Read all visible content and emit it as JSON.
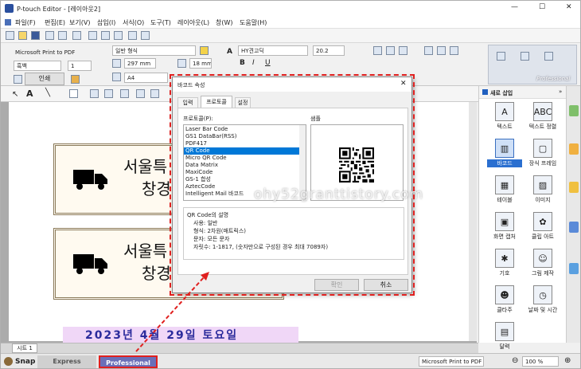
{
  "window": {
    "title": "P-touch Editor - [레이아웃2]",
    "controls": {
      "minimize": "—",
      "maximize": "☐",
      "close": "✕"
    }
  },
  "menu": [
    "파일(F)",
    "편집(E)",
    "보기(V)",
    "삽입(I)",
    "서식(O)",
    "도구(T)",
    "레이아웃(L)",
    "창(W)",
    "도움말(H)"
  ],
  "ribbon": {
    "printer": "Microsoft Print to PDF",
    "color": "흑백",
    "copies": "1",
    "print_label": "인쇄",
    "paper_format": "일반 형식",
    "width": "297 mm",
    "height": "18 mm",
    "paper_size": "A4",
    "font": "HY견고딕",
    "font_size": "20.2",
    "bold": "B",
    "italic": "I",
    "underline": "U",
    "tbox": "A",
    "mode_label": "Professional"
  },
  "right_panel": {
    "title": "새로 삽입",
    "items": [
      {
        "label": "텍스트",
        "glyph": "A"
      },
      {
        "label": "텍스트 정렬",
        "glyph": "ABC"
      },
      {
        "label": "바코드",
        "glyph": "▥"
      },
      {
        "label": "장식 프레임",
        "glyph": "▢"
      },
      {
        "label": "테이블",
        "glyph": "▦"
      },
      {
        "label": "이미지",
        "glyph": "▨"
      },
      {
        "label": "화면 캡처",
        "glyph": "▣"
      },
      {
        "label": "클립 아트",
        "glyph": "✿"
      },
      {
        "label": "기호",
        "glyph": "✱"
      },
      {
        "label": "그림 제작",
        "glyph": "☺"
      },
      {
        "label": "클타주",
        "glyph": "☻"
      },
      {
        "label": "날짜 및 시간",
        "glyph": "◷"
      },
      {
        "label": "달력",
        "glyph": "▤"
      }
    ]
  },
  "canvas": {
    "card_text_1": "서울특",
    "card_text_2": "창경",
    "date_text": "2023년 4월 29일 토요일"
  },
  "dialog": {
    "title": "바코드 속성",
    "close": "✕",
    "tabs": [
      "입력",
      "프로토콜",
      "설정"
    ],
    "protocol_label": "프로토콜(P):",
    "sample_label": "샘플",
    "protocols": [
      "Laser Bar Code",
      "GS1 DataBar(RSS)",
      "PDF417",
      "QR Code",
      "Micro QR Code",
      "Data Matrix",
      "MaxiCode",
      "GS-1 합성",
      "AztecCode",
      "Intelligent Mail 바코드"
    ],
    "selected_protocol": "QR Code",
    "desc_title": "QR Code의 설명",
    "desc_lines": [
      "사용: 일반",
      "형식: 2차원(매트릭스)",
      "문자: 모든 문자",
      "자릿수: 1-1817, (숫자만으로 구성된 경우 최대 7089자)"
    ],
    "ok": "확인",
    "cancel": "취소"
  },
  "watermark": "ohy52granttistory.com",
  "status": {
    "sheet_tab": "시트 1",
    "snap": "Snap",
    "express": "Express",
    "professional": "Professional",
    "printer": "Microsoft Print to PDF",
    "zoom": "100 %"
  },
  "colors": {
    "accent": "#0078d7",
    "highlight": "#e0201f",
    "mode_active": "#6a6fb8"
  }
}
